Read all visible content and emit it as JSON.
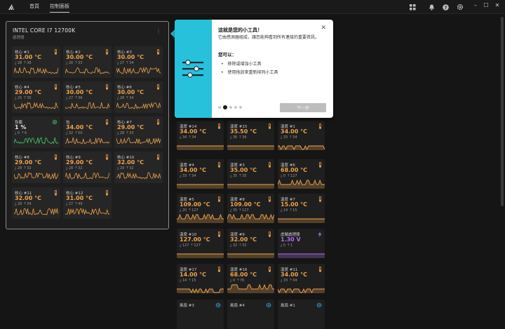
{
  "nav": {
    "home": "首頁",
    "dashboard": "控制面板"
  },
  "cpu": {
    "title": "INTEL CORE I7 12700K",
    "subtitle": "處理器",
    "tiles": [
      {
        "label": "核心 #1",
        "value": "31.00 °C",
        "min": "28",
        "max": "38",
        "icon": "thermometer-icon"
      },
      {
        "label": "核心 #2",
        "value": "30.00 °C",
        "min": "26",
        "max": "33",
        "icon": "thermometer-icon"
      },
      {
        "label": "核心 #3",
        "value": "30.00 °C",
        "min": "27",
        "max": "34",
        "icon": "thermometer-icon"
      },
      {
        "label": "核心 #4",
        "value": "29.00 °C",
        "min": "25",
        "max": "35",
        "icon": "thermometer-icon"
      },
      {
        "label": "核心 #5",
        "value": "30.00 °C",
        "min": "27",
        "max": "36",
        "icon": "thermometer-icon"
      },
      {
        "label": "核心 #6",
        "value": "30.00 °C",
        "min": "28",
        "max": "34",
        "icon": "thermometer-icon"
      },
      {
        "label": "負載",
        "value": "1 %",
        "min": "0",
        "max": "6",
        "icon": "gear-icon"
      },
      {
        "label": "包",
        "value": "34.00 °C",
        "min": "32",
        "max": "50",
        "icon": "thermometer-icon"
      },
      {
        "label": "核心 #7",
        "value": "29.00 °C",
        "min": "28",
        "max": "33",
        "icon": "thermometer-icon"
      },
      {
        "label": "核心 #8",
        "value": "29.00 °C",
        "min": "28",
        "max": "32",
        "icon": "thermometer-icon"
      },
      {
        "label": "核心 #9",
        "value": "29.00 °C",
        "min": "28",
        "max": "32",
        "icon": "thermometer-icon"
      },
      {
        "label": "核心 #10",
        "value": "32.00 °C",
        "min": "29",
        "max": "32",
        "icon": "thermometer-icon"
      },
      {
        "label": "核心 #11",
        "value": "32.00 °C",
        "min": "28",
        "max": "34",
        "icon": "thermometer-icon"
      },
      {
        "label": "核心 #12",
        "value": "31.00 °C",
        "min": "27",
        "max": "49",
        "icon": "thermometer-icon"
      }
    ]
  },
  "grid": [
    {
      "label": "溫度 #14",
      "value": "34.00 °C",
      "min": "34",
      "max": "34",
      "icon": "thermometer-icon"
    },
    {
      "label": "溫度 #15",
      "value": "35.50 °C",
      "min": "36",
      "max": "36",
      "icon": "thermometer-icon"
    },
    {
      "label": "溫度 #1",
      "value": "34.00 °C",
      "min": "33",
      "max": "34",
      "icon": "thermometer-icon"
    },
    {
      "label": "溫度 #4",
      "value": "34.00 °C",
      "min": "33",
      "max": "34",
      "icon": "thermometer-icon"
    },
    {
      "label": "溫度 #3",
      "value": "35.00 °C",
      "min": "35",
      "max": "35",
      "icon": "thermometer-icon"
    },
    {
      "label": "溫度 #6",
      "value": "68.00 °C",
      "min": "0",
      "max": "127",
      "icon": "thermometer-icon"
    },
    {
      "label": "溫度 #5",
      "value": "109.00 °C",
      "min": "20",
      "max": "127",
      "icon": "thermometer-icon"
    },
    {
      "label": "溫度 #8",
      "value": "109.00 °C",
      "min": "35",
      "max": "127",
      "icon": "thermometer-icon"
    },
    {
      "label": "溫度 #7",
      "value": "15.00 °C",
      "min": "14",
      "max": "15",
      "icon": "thermometer-icon"
    },
    {
      "label": "溫度 #10",
      "value": "127.00 °C",
      "min": "127",
      "max": "127",
      "icon": "thermometer-icon"
    },
    {
      "label": "溫度 #9",
      "value": "32.00 °C",
      "min": "32",
      "max": "32",
      "icon": "thermometer-icon"
    },
    {
      "label": "虛擬處理器",
      "value": "1.30 V",
      "min": "0",
      "max": "1",
      "icon": "lightning-icon"
    },
    {
      "label": "溫度 #17",
      "value": "14.00 °C",
      "min": "14",
      "max": "15",
      "icon": "thermometer-icon"
    },
    {
      "label": "溫度 #16",
      "value": "68.00 °C",
      "min": "0",
      "max": "76",
      "icon": "thermometer-icon"
    },
    {
      "label": "溫度 #11",
      "value": "34.00 °C",
      "min": "33",
      "max": "34",
      "icon": "thermometer-icon"
    },
    {
      "label": "風扇 #3",
      "value": "",
      "min": "",
      "max": "",
      "icon": "fan-icon"
    },
    {
      "label": "風扇 #4",
      "value": "",
      "min": "",
      "max": "",
      "icon": "fan-icon"
    },
    {
      "label": "風扇 #1",
      "value": "",
      "min": "",
      "max": "",
      "icon": "fan-icon"
    }
  ],
  "tooltip": {
    "title": "這就是您的小工具！",
    "body": "它由感測器組成，讓您能夠看到所有連接的重要資訊。",
    "can": "您可以：",
    "items": [
      "移除或增加小工具",
      "使用拖放來重新排列小工具"
    ],
    "next": "下一步"
  },
  "colors": {
    "accent": "#f0a24a",
    "tooltip": "#27c1db",
    "voltage": "#b06cf0",
    "load": "#4bc86a",
    "fan": "#3fa7e6"
  }
}
